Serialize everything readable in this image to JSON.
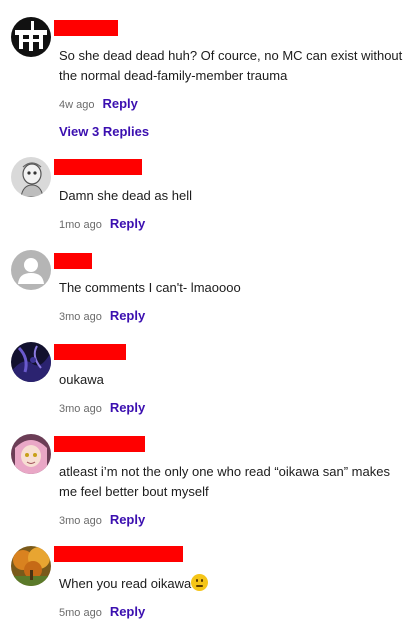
{
  "comments": [
    {
      "text": "So she dead dead huh? Of cource, no MC can exist without the normal dead-family-member trauma",
      "time": "4w ago",
      "reply_label": "Reply",
      "view_replies": "View 3 Replies",
      "avatar": "black-white-logo-avatar"
    },
    {
      "text": "Damn she dead as hell",
      "time": "1mo ago",
      "reply_label": "Reply",
      "avatar": "sketch-avatar"
    },
    {
      "text": "The comments I can't- lmaoooo",
      "time": "3mo ago",
      "reply_label": "Reply",
      "avatar": "default-user-avatar"
    },
    {
      "text": "oukawa",
      "time": "3mo ago",
      "reply_label": "Reply",
      "avatar": "dark-purple-avatar"
    },
    {
      "text": "atleast i’m not the only one who read “oikawa san” makes me feel better bout myself",
      "time": "3mo ago",
      "reply_label": "Reply",
      "avatar": "anime-girl-avatar"
    },
    {
      "text": "When you read oikawa",
      "emoji": "thinking-face",
      "time": "5mo ago",
      "reply_label": "Reply",
      "avatar": "autumn-tree-avatar"
    }
  ],
  "colors": {
    "redaction": "#ff0000",
    "link": "#3b0fb0",
    "meta_text": "#6b6b6b"
  }
}
